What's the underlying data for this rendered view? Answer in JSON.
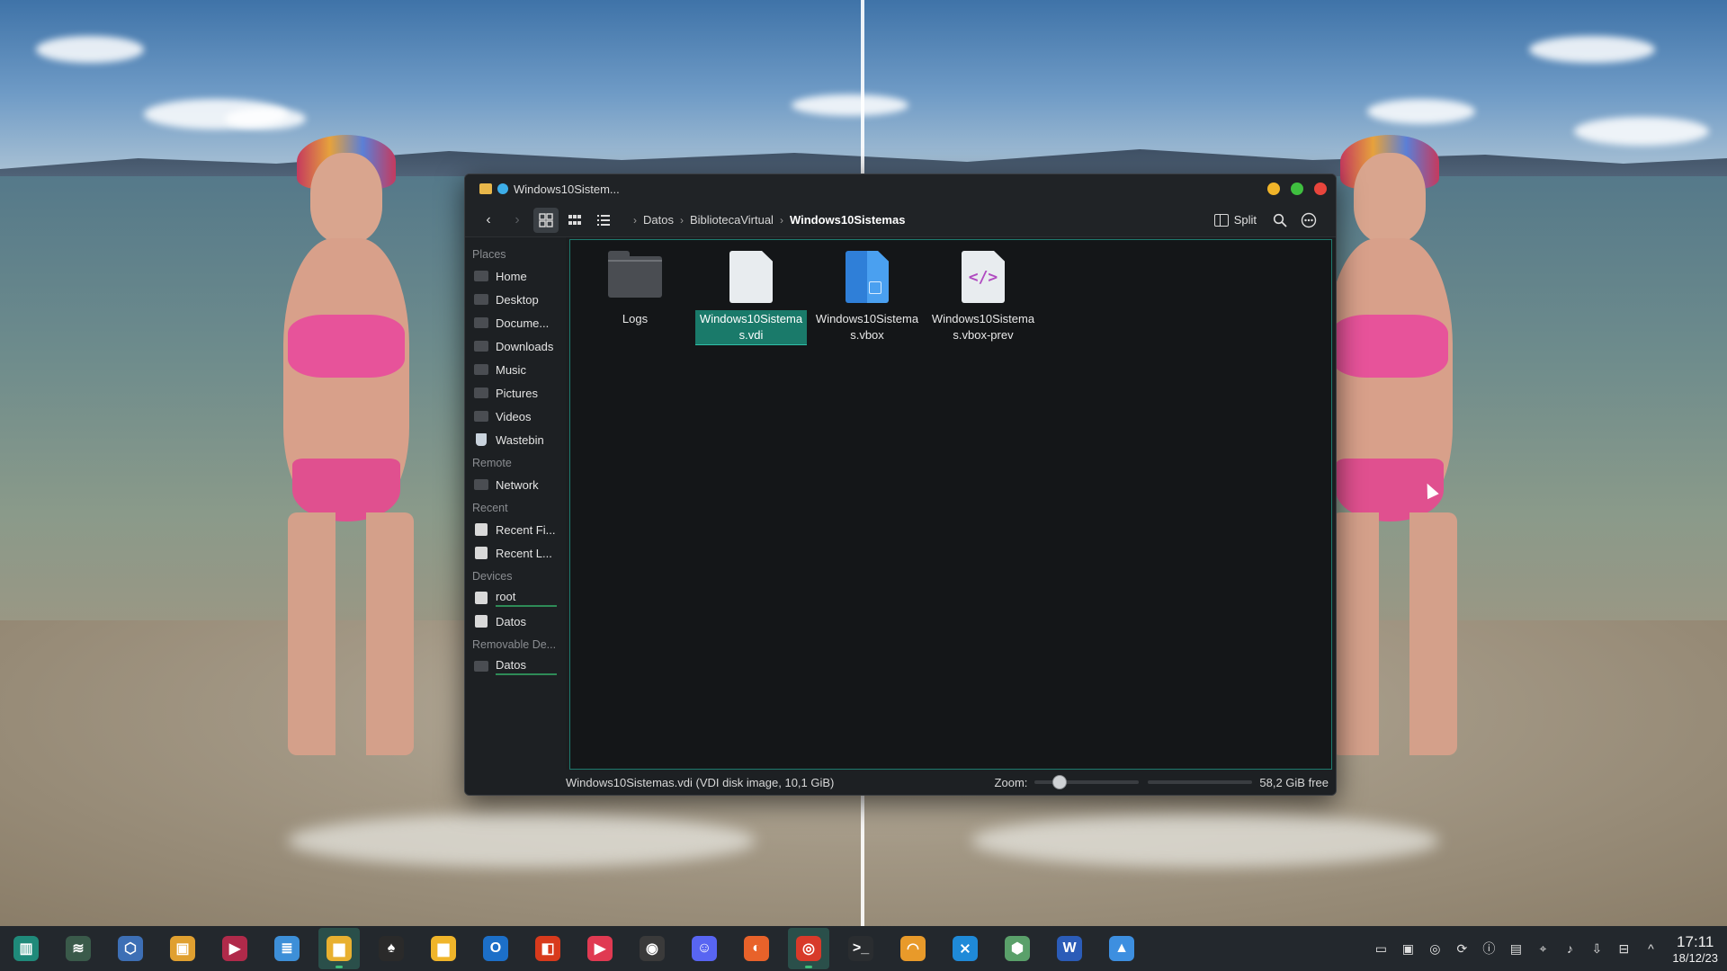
{
  "window": {
    "title": "Windows10Sistem...",
    "controls": {
      "minimize": "minimize",
      "maximize": "maximize",
      "close": "close"
    }
  },
  "toolbar": {
    "back_icon": "‹",
    "forward_icon": "›",
    "split_label": "Split",
    "breadcrumb": [
      "Datos",
      "BibliotecaVirtual",
      "Windows10Sistemas"
    ]
  },
  "sidebar": {
    "places_title": "Places",
    "places": [
      "Home",
      "Desktop",
      "Docume...",
      "Downloads",
      "Music",
      "Pictures",
      "Videos",
      "Wastebin"
    ],
    "remote_title": "Remote",
    "remote": [
      "Network"
    ],
    "recent_title": "Recent",
    "recent": [
      "Recent Fi...",
      "Recent L..."
    ],
    "devices_title": "Devices",
    "devices": [
      "root",
      "Datos"
    ],
    "removable_title": "Removable De...",
    "removable": [
      "Datos"
    ]
  },
  "files": [
    {
      "name": "Logs",
      "kind": "folder"
    },
    {
      "name": "Windows10Sistemas.vdi",
      "kind": "vdi",
      "selected": true
    },
    {
      "name": "Windows10Sistemas.vbox",
      "kind": "vbox"
    },
    {
      "name": "Windows10Sistemas.vbox-prev",
      "kind": "code"
    }
  ],
  "code_glyph": "</>",
  "status": {
    "text": "Windows10Sistemas.vdi (VDI disk image, 10,1 GiB)",
    "zoom_label": "Zoom:",
    "zoom_level_fraction": 0.2,
    "free_space": "58,2 GiB free",
    "used_fraction": 0.78
  },
  "taskbar": {
    "apps": [
      {
        "name": "app-launcher",
        "glyph": "▥",
        "color": "#1f8a7a"
      },
      {
        "name": "system-monitor",
        "glyph": "≋",
        "color": "#3a5a4a"
      },
      {
        "name": "virtualbox",
        "glyph": "⬡",
        "color": "#3d6fb5"
      },
      {
        "name": "software-store",
        "glyph": "▣",
        "color": "#e0a030"
      },
      {
        "name": "video-editor",
        "glyph": "▶",
        "color": "#b02a4a"
      },
      {
        "name": "text-editor",
        "glyph": "≣",
        "color": "#3d8fd8"
      },
      {
        "name": "file-manager",
        "glyph": "▆",
        "color": "#e8b030",
        "active": true
      },
      {
        "name": "inkscape",
        "glyph": "♠",
        "color": "#2a2a2a"
      },
      {
        "name": "files",
        "glyph": "▆",
        "color": "#f0b52a"
      },
      {
        "name": "outlook",
        "glyph": "O",
        "color": "#1c6fc8"
      },
      {
        "name": "office",
        "glyph": "◧",
        "color": "#d83a1c"
      },
      {
        "name": "media-player",
        "glyph": "▶",
        "color": "#e03a52"
      },
      {
        "name": "obs",
        "glyph": "◉",
        "color": "#3a3a3a"
      },
      {
        "name": "discord",
        "glyph": "☺",
        "color": "#5865f2"
      },
      {
        "name": "firefox",
        "glyph": "◐",
        "color": "#e8622a"
      },
      {
        "name": "chrome",
        "glyph": "◎",
        "color": "#d83a2a",
        "active": true
      },
      {
        "name": "terminal",
        "glyph": ">_",
        "color": "#2a2d30"
      },
      {
        "name": "image-viewer",
        "glyph": "◠",
        "color": "#e89a2a"
      },
      {
        "name": "vscode",
        "glyph": "⨯",
        "color": "#1f8ad8"
      },
      {
        "name": "3d-tool",
        "glyph": "⬢",
        "color": "#5aa06a"
      },
      {
        "name": "word",
        "glyph": "W",
        "color": "#2b5cb8"
      },
      {
        "name": "photos",
        "glyph": "▲",
        "color": "#3d8fe0"
      }
    ],
    "clock_time": "17:11",
    "clock_date": "18/12/23"
  },
  "colors": {
    "accent": "#1a7a6a",
    "window_bg": "#1b1e20",
    "content_bg": "#141618"
  }
}
